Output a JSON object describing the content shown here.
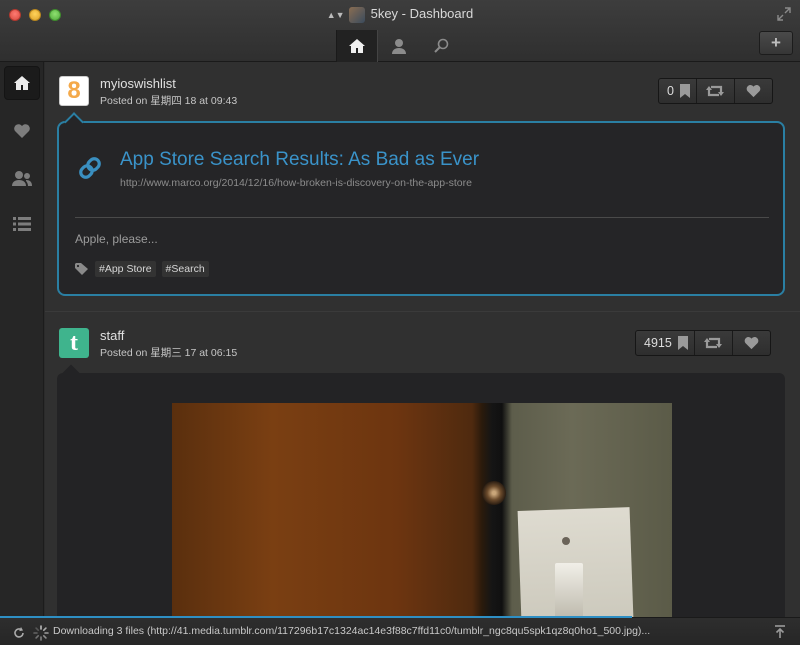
{
  "window": {
    "title": "5key - Dashboard"
  },
  "toolbar": {
    "add_label": "+"
  },
  "posts": [
    {
      "username": "myioswishlist",
      "posted_prefix": "Posted on ",
      "posted_date": "星期四 18 at 09:43",
      "avatar_glyph": "8",
      "bookmark_count": "0",
      "link_title": "App Store Search Results: As Bad as Ever",
      "link_url": "http://www.marco.org/2014/12/16/how-broken-is-discovery-on-the-app-store",
      "body": "Apple, please...",
      "tags": [
        "#App Store",
        "#Search"
      ]
    },
    {
      "username": "staff",
      "posted_prefix": "Posted on ",
      "posted_date": "星期三 17 at 06:15",
      "avatar_glyph": "t",
      "bookmark_count": "4915"
    }
  ],
  "status": {
    "text": "Downloading 3 files (http://41.media.tumblr.com/117296b17c1324ac14e3f88c7ffd11c0/tumblr_ngc8qu5spk1qz8q0ho1_500.jpg)..."
  }
}
